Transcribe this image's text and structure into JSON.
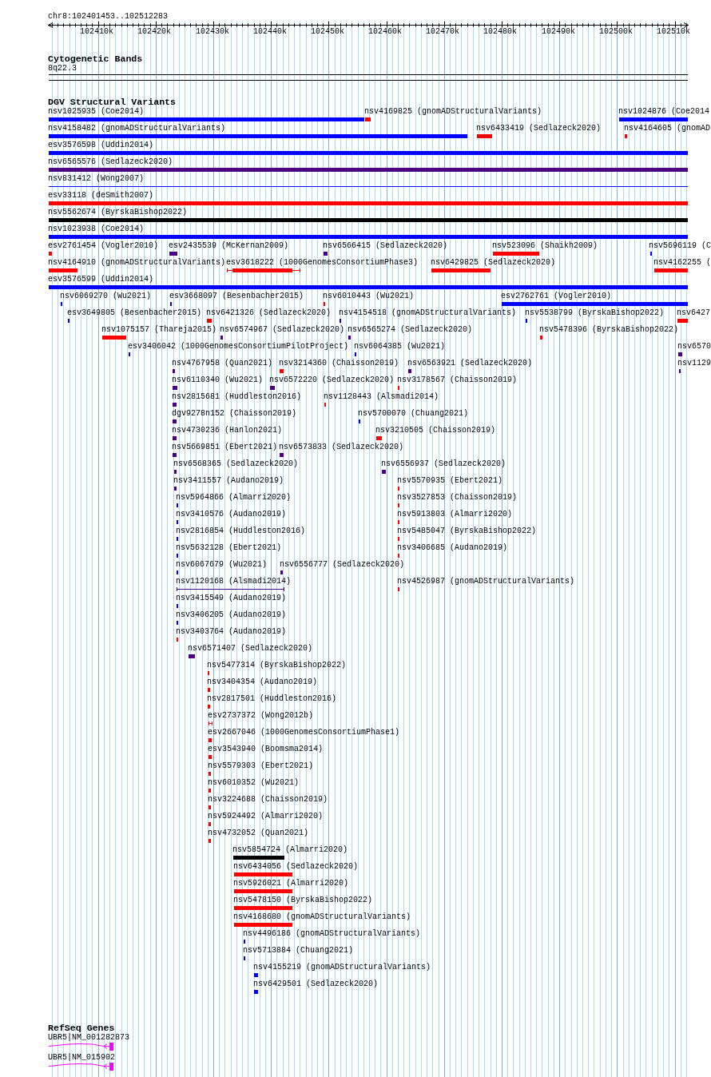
{
  "ruler": {
    "label": "chr8:102401453..102512283",
    "ticks": [
      {
        "label": "102410k"
      },
      {
        "label": "102420k"
      },
      {
        "label": "102430k"
      },
      {
        "label": "102440k"
      },
      {
        "label": "102450k"
      },
      {
        "label": "102460k"
      },
      {
        "label": "102470k"
      },
      {
        "label": "102480k"
      },
      {
        "label": "102490k"
      },
      {
        "label": "102500k"
      },
      {
        "label": "102510k"
      }
    ]
  },
  "tracks": [
    {
      "kind": "cytoband",
      "title": "Cytogenetic Bands",
      "bands": [
        {
          "label": "8q22.3"
        }
      ]
    },
    {
      "kind": "variants",
      "title": "DGV Structural Variants",
      "rows": [
        {
          "features": [
            {
              "kind": "bar",
              "label": "nsv1025935 (Coe2014)",
              "color": "#0000ff"
            },
            {
              "kind": "bar",
              "label": "nsv4169825 (gnomADStructuralVariants)",
              "color": "#ff0000"
            },
            {
              "kind": "bar",
              "label": "nsv1024876 (Coe2014",
              "color": "#0000ff"
            }
          ]
        },
        {
          "features": [
            {
              "kind": "bar",
              "label": "nsv4158482 (gnomADStructuralVariants)",
              "color": "#0000ff"
            },
            {
              "kind": "bar",
              "label": "nsv6433419 (Sedlazeck2020)",
              "color": "#ff0000"
            },
            {
              "kind": "bar",
              "label": "nsv4164605 (gnomAD",
              "color": "#ff0000"
            }
          ]
        },
        {
          "features": [
            {
              "kind": "bar",
              "label": "esv3576598 (Uddin2014)",
              "color": "#0000ff"
            }
          ]
        },
        {
          "features": [
            {
              "kind": "bar",
              "label": "nsv6565576 (Sedlazeck2020)",
              "color": "#4b0082"
            }
          ]
        },
        {
          "features": [
            {
              "kind": "line",
              "label": "nsv831412 (Wong2007)",
              "color": "#0000ff"
            }
          ]
        },
        {
          "features": [
            {
              "kind": "bar",
              "label": "esv33118 (deSmith2007)",
              "color": "#ff0000"
            }
          ]
        },
        {
          "features": [
            {
              "kind": "bar",
              "label": "nsv5562674 (ByrskaBishop2022)",
              "color": "#000000"
            }
          ]
        },
        {
          "features": [
            {
              "kind": "bar",
              "label": "nsv1023938 (Coe2014)",
              "color": "#0000ff"
            }
          ]
        },
        {
          "features": [
            {
              "kind": "bar",
              "label": "esv2761454 (Vogler2010)",
              "color": "#ff0000"
            },
            {
              "kind": "bar",
              "label": "esv2435539 (McKernan2009)",
              "color": "#4b0082"
            },
            {
              "kind": "bar",
              "label": "nsv6566415 (Sedlazeck2020)",
              "color": "#4b0082"
            },
            {
              "kind": "bar",
              "label": "nsv523096 (Shaikh2009)",
              "color": "#ff0000"
            },
            {
              "kind": "bar",
              "label": "nsv5696119 (C",
              "color": "#0000ff"
            }
          ]
        },
        {
          "features": [
            {
              "kind": "bar",
              "label": "nsv4164910 (gnomADStructuralVariants)",
              "color": "#ff0000"
            },
            {
              "kind": "interval",
              "label": "esv3618222 (1000GenomesConsortiumPhase3)",
              "color": "#ff0000"
            },
            {
              "kind": "bar",
              "label": "nsv6429825 (Sedlazeck2020)",
              "color": "#ff0000"
            },
            {
              "kind": "bar",
              "label": "nsv4162255 (",
              "color": "#ff0000"
            }
          ]
        },
        {
          "features": [
            {
              "kind": "bar",
              "label": "esv3576599 (Uddin2014)",
              "color": "#0000ff"
            }
          ]
        },
        {
          "features": [
            {
              "kind": "bar",
              "label": "nsv6069270 (Wu2021)",
              "color": "#0000ff"
            },
            {
              "kind": "bar",
              "label": "esv3668097 (Besenbacher2015)",
              "color": "#0000ff"
            },
            {
              "kind": "bar",
              "label": "nsv6010443 (Wu2021)",
              "color": "#ff0000"
            },
            {
              "kind": "bar",
              "label": "esv2762761 (Vogler2010)",
              "color": "#0000ff"
            }
          ]
        },
        {
          "features": [
            {
              "kind": "bar",
              "label": "esv3649805 (Besenbacher2015)",
              "color": "#0000ff"
            },
            {
              "kind": "bar",
              "label": "nsv6421326 (Sedlazeck2020)",
              "color": "#ff0000"
            },
            {
              "kind": "bar",
              "label": "nsv4154518 (gnomADStructuralVariants)",
              "color": "#0000ff"
            },
            {
              "kind": "bar",
              "label": "nsv5538799 (ByrskaBishop2022)",
              "color": "#0000ff"
            },
            {
              "kind": "bar",
              "label": "nsv6427",
              "color": "#ff0000"
            }
          ]
        },
        {
          "features": [
            {
              "kind": "bar",
              "label": "nsv1075157 (Thareja2015)",
              "color": "#ff0000"
            },
            {
              "kind": "bar",
              "label": "nsv6574967 (Sedlazeck2020)",
              "color": "#4b0082"
            },
            {
              "kind": "bar",
              "label": "nsv6565274 (Sedlazeck2020)",
              "color": "#4b0082"
            },
            {
              "kind": "bar",
              "label": "nsv5478396 (ByrskaBishop2022)",
              "color": "#ff0000"
            }
          ]
        },
        {
          "features": [
            {
              "kind": "bar",
              "label": "esv3406042 (1000GenomesConsortiumPilotProject)",
              "color": "#0000ff"
            },
            {
              "kind": "bar",
              "label": "nsv6064385 (Wu2021)",
              "color": "#0000ff"
            },
            {
              "kind": "bar",
              "label": "nsv6570",
              "color": "#4b0082"
            }
          ]
        },
        {
          "features": [
            {
              "kind": "bar",
              "label": "nsv4767958 (Quan2021)",
              "color": "#4b0082"
            },
            {
              "kind": "bar",
              "label": "nsv3214360 (Chaisson2019)",
              "color": "#ff0000"
            },
            {
              "kind": "bar",
              "label": "nsv6563921 (Sedlazeck2020)",
              "color": "#4b0082"
            },
            {
              "kind": "bar",
              "label": "nsv1129",
              "color": "#4b0082"
            }
          ]
        },
        {
          "features": [
            {
              "kind": "bar",
              "label": "nsv6110340 (Wu2021)",
              "color": "#4b0082"
            },
            {
              "kind": "bar",
              "label": "nsv6572220 (Sedlazeck2020)",
              "color": "#4b0082"
            },
            {
              "kind": "bar",
              "label": "nsv3178567 (Chaisson2019)",
              "color": "#ff0000"
            }
          ]
        },
        {
          "features": [
            {
              "kind": "bar",
              "label": "nsv2815681 (Huddleston2016)",
              "color": "#4b0082"
            },
            {
              "kind": "bar",
              "label": "nsv1128443 (Alsmadi2014)",
              "color": "#ff0000"
            }
          ]
        },
        {
          "features": [
            {
              "kind": "bar",
              "label": "dgv9278n152 (Chaisson2019)",
              "color": "#4b0082"
            },
            {
              "kind": "bar",
              "label": "nsv5700070 (Chuang2021)",
              "color": "#0000ff"
            }
          ]
        },
        {
          "features": [
            {
              "kind": "bar",
              "label": "nsv4730236 (Hanlon2021)",
              "color": "#4b0082"
            },
            {
              "kind": "bar",
              "label": "nsv3210505 (Chaisson2019)",
              "color": "#ff0000"
            }
          ]
        },
        {
          "features": [
            {
              "kind": "bar",
              "label": "nsv5669851 (Ebert2021)",
              "color": "#4b0082"
            },
            {
              "kind": "bar",
              "label": "nsv6573833 (Sedlazeck2020)",
              "color": "#4b0082"
            }
          ]
        },
        {
          "features": [
            {
              "kind": "bar",
              "label": "nsv6568365 (Sedlazeck2020)",
              "color": "#4b0082"
            },
            {
              "kind": "bar",
              "label": "nsv6556937 (Sedlazeck2020)",
              "color": "#4b0082"
            }
          ]
        },
        {
          "features": [
            {
              "kind": "bar",
              "label": "nsv3411557 (Audano2019)",
              "color": "#4b0082"
            },
            {
              "kind": "bar",
              "label": "nsv5570935 (Ebert2021)",
              "color": "#ff0000"
            }
          ]
        },
        {
          "features": [
            {
              "kind": "bar",
              "label": "nsv5964866 (Almarri2020)",
              "color": "#0000ff"
            },
            {
              "kind": "bar",
              "label": "nsv3527853 (Chaisson2019)",
              "color": "#ff0000"
            }
          ]
        },
        {
          "features": [
            {
              "kind": "bar",
              "label": "nsv3410576 (Audano2019)",
              "color": "#0000ff"
            },
            {
              "kind": "bar",
              "label": "nsv5913803 (Almarri2020)",
              "color": "#ff0000"
            }
          ]
        },
        {
          "features": [
            {
              "kind": "bar",
              "label": "nsv2816854 (Huddleston2016)",
              "color": "#0000ff"
            },
            {
              "kind": "bar",
              "label": "nsv5485047 (ByrskaBishop2022)",
              "color": "#ff0000"
            }
          ]
        },
        {
          "features": [
            {
              "kind": "bar",
              "label": "nsv5632128 (Ebert2021)",
              "color": "#0000ff"
            },
            {
              "kind": "bar",
              "label": "nsv3406685 (Audano2019)",
              "color": "#ff0000"
            }
          ]
        },
        {
          "features": [
            {
              "kind": "bar",
              "label": "nsv6067679 (Wu2021)",
              "color": "#0000ff"
            },
            {
              "kind": "bar",
              "label": "nsv6556777 (Sedlazeck2020)",
              "color": "#4b0082"
            }
          ]
        },
        {
          "features": [
            {
              "kind": "interval",
              "label": "nsv1120168 (Alsmadi2014)",
              "color": "#4b0082"
            },
            {
              "kind": "bar",
              "label": "nsv4526987 (gnomADStructuralVariants)",
              "color": "#ff0000"
            }
          ]
        },
        {
          "features": [
            {
              "kind": "bar",
              "label": "nsv3415549 (Audano2019)",
              "color": "#0000ff"
            }
          ]
        },
        {
          "features": [
            {
              "kind": "bar",
              "label": "nsv3406205 (Audano2019)",
              "color": "#0000ff"
            }
          ]
        },
        {
          "features": [
            {
              "kind": "bar",
              "label": "nsv3403764 (Audano2019)",
              "color": "#ff0000"
            }
          ]
        },
        {
          "features": [
            {
              "kind": "bar",
              "label": "nsv6571407 (Sedlazeck2020)",
              "color": "#4b0082"
            }
          ]
        },
        {
          "features": [
            {
              "kind": "bar",
              "label": "nsv5477314 (ByrskaBishop2022)",
              "color": "#ff0000"
            }
          ]
        },
        {
          "features": [
            {
              "kind": "bar",
              "label": "nsv3404354 (Audano2019)",
              "color": "#ff0000"
            }
          ]
        },
        {
          "features": [
            {
              "kind": "bar",
              "label": "nsv2817501 (Huddleston2016)",
              "color": "#ff0000"
            }
          ]
        },
        {
          "features": [
            {
              "kind": "interval",
              "label": "esv2737372 (Wong2012b)",
              "color": "#ff0000"
            }
          ]
        },
        {
          "features": [
            {
              "kind": "bar",
              "label": "esv2667046 (1000GenomesConsortiumPhase1)",
              "color": "#ff0000"
            }
          ]
        },
        {
          "features": [
            {
              "kind": "bar",
              "label": "esv3543940 (Boomsma2014)",
              "color": "#ff0000"
            }
          ]
        },
        {
          "features": [
            {
              "kind": "bar",
              "label": "nsv5579303 (Ebert2021)",
              "color": "#ff0000"
            }
          ]
        },
        {
          "features": [
            {
              "kind": "bar",
              "label": "nsv6010352 (Wu2021)",
              "color": "#ff0000"
            }
          ]
        },
        {
          "features": [
            {
              "kind": "bar",
              "label": "nsv3224688 (Chaisson2019)",
              "color": "#ff0000"
            }
          ]
        },
        {
          "features": [
            {
              "kind": "bar",
              "label": "nsv5924492 (Almarri2020)",
              "color": "#ff0000"
            }
          ]
        },
        {
          "features": [
            {
              "kind": "bar",
              "label": "nsv4732052 (Quan2021)",
              "color": "#ff0000"
            }
          ]
        },
        {
          "features": [
            {
              "kind": "bar",
              "label": "nsv5854724 (Almarri2020)",
              "color": "#000000"
            }
          ]
        },
        {
          "features": [
            {
              "kind": "bar",
              "label": "nsv6434056 (Sedlazeck2020)",
              "color": "#ff0000"
            }
          ]
        },
        {
          "features": [
            {
              "kind": "bar",
              "label": "nsv5926021 (Almarri2020)",
              "color": "#ff0000"
            }
          ]
        },
        {
          "features": [
            {
              "kind": "bar",
              "label": "nsv5478150 (ByrskaBishop2022)",
              "color": "#ff0000"
            }
          ]
        },
        {
          "features": [
            {
              "kind": "bar",
              "label": "nsv4168680 (gnomADStructuralVariants)",
              "color": "#ff0000"
            }
          ]
        },
        {
          "features": [
            {
              "kind": "bar",
              "label": "nsv4496186 (gnomADStructuralVariants)",
              "color": "#0000ff"
            }
          ]
        },
        {
          "features": [
            {
              "kind": "bar",
              "label": "nsv5713884 (Chuang2021)",
              "color": "#0000ff"
            }
          ]
        },
        {
          "features": [
            {
              "kind": "bar",
              "label": "nsv4155219 (gnomADStructuralVariants)",
              "color": "#0000ff"
            }
          ]
        },
        {
          "features": [
            {
              "kind": "bar",
              "label": "nsv6429501 (Sedlazeck2020)",
              "color": "#0000ff"
            }
          ]
        }
      ]
    },
    {
      "kind": "genes",
      "title": "RefSeq Genes",
      "genes": [
        {
          "label": "UBR5|NM_001282873",
          "reverse_strand": true
        },
        {
          "label": "UBR5|NM_015902",
          "reverse_strand": true
        }
      ]
    }
  ]
}
